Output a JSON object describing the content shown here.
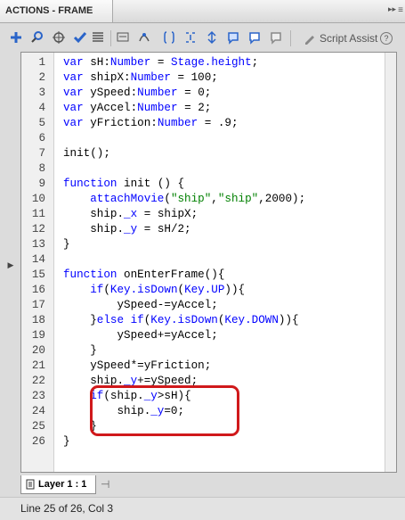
{
  "panel": {
    "title": "ACTIONS - FRAME",
    "collapse_icon": "collapse-arrows-icon",
    "menu_icon": "panel-menu-icon"
  },
  "toolbar": {
    "icons": [
      "add-new-item-icon",
      "find-icon",
      "insert-target-path-icon",
      "check-syntax-icon",
      "auto-format-icon",
      "show-code-hint-icon",
      "debug-options-icon",
      "collapse-between-braces-icon",
      "collapse-selection-icon",
      "expand-all-icon",
      "apply-block-comment-icon",
      "apply-line-comment-icon",
      "remove-comment-icon"
    ],
    "script_assist_label": "Script Assist",
    "help_icon": "help-icon"
  },
  "code": {
    "lines": [
      {
        "n": "1",
        "text": "var sH:Number = Stage.height;"
      },
      {
        "n": "2",
        "text": "var shipX:Number = 100;"
      },
      {
        "n": "3",
        "text": "var ySpeed:Number = 0;"
      },
      {
        "n": "4",
        "text": "var yAccel:Number = 2;"
      },
      {
        "n": "5",
        "text": "var yFriction:Number = .9;"
      },
      {
        "n": "6",
        "text": ""
      },
      {
        "n": "7",
        "text": "init();"
      },
      {
        "n": "8",
        "text": ""
      },
      {
        "n": "9",
        "text": "function init () {"
      },
      {
        "n": "10",
        "text": "    attachMovie(\"ship\",\"ship\",2000);"
      },
      {
        "n": "11",
        "text": "    ship._x = shipX;"
      },
      {
        "n": "12",
        "text": "    ship._y = sH/2;"
      },
      {
        "n": "13",
        "text": "}"
      },
      {
        "n": "14",
        "text": ""
      },
      {
        "n": "15",
        "text": "function onEnterFrame(){"
      },
      {
        "n": "16",
        "text": "    if(Key.isDown(Key.UP)){"
      },
      {
        "n": "17",
        "text": "        ySpeed-=yAccel;"
      },
      {
        "n": "18",
        "text": "    }else if(Key.isDown(Key.DOWN)){"
      },
      {
        "n": "19",
        "text": "        ySpeed+=yAccel;"
      },
      {
        "n": "20",
        "text": "    }"
      },
      {
        "n": "21",
        "text": "    ySpeed*=yFriction;"
      },
      {
        "n": "22",
        "text": "    ship._y+=ySpeed;"
      },
      {
        "n": "23",
        "text": "    if(ship._y>sH){"
      },
      {
        "n": "24",
        "text": "        ship._y=0;"
      },
      {
        "n": "25",
        "text": "    }"
      },
      {
        "n": "26",
        "text": "}"
      }
    ]
  },
  "highlight": {
    "color": "#d0191b",
    "from_line": 23,
    "to_line": 25
  },
  "tabs": {
    "layer_label": "Layer 1 : 1"
  },
  "status": {
    "text": "Line 25 of 26, Col 3"
  },
  "colors": {
    "keyword": "#0000ff",
    "string": "#008000",
    "text": "#000000"
  }
}
